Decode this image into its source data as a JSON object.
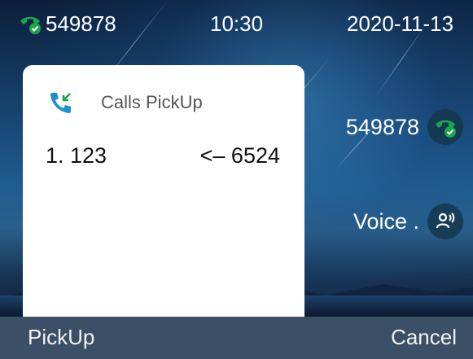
{
  "status_bar": {
    "extension": "549878",
    "time": "10:30",
    "date": "2020-11-13"
  },
  "popup": {
    "title": "Calls PickUp",
    "icon": "incoming-call-icon",
    "calls": [
      {
        "entry": "1. 123",
        "from": "<– 6524"
      }
    ]
  },
  "line_keys": [
    {
      "label": "549878",
      "icon": "phone-registered-icon"
    },
    {
      "label": "Voice .",
      "icon": "voice-user-icon"
    }
  ],
  "softkeys": {
    "left": "PickUp",
    "right": "Cancel"
  },
  "colors": {
    "accent_green": "#1aa64a",
    "popup_icon_blue": "#1b8fd6",
    "softkey_bar": "#3b4f66"
  }
}
